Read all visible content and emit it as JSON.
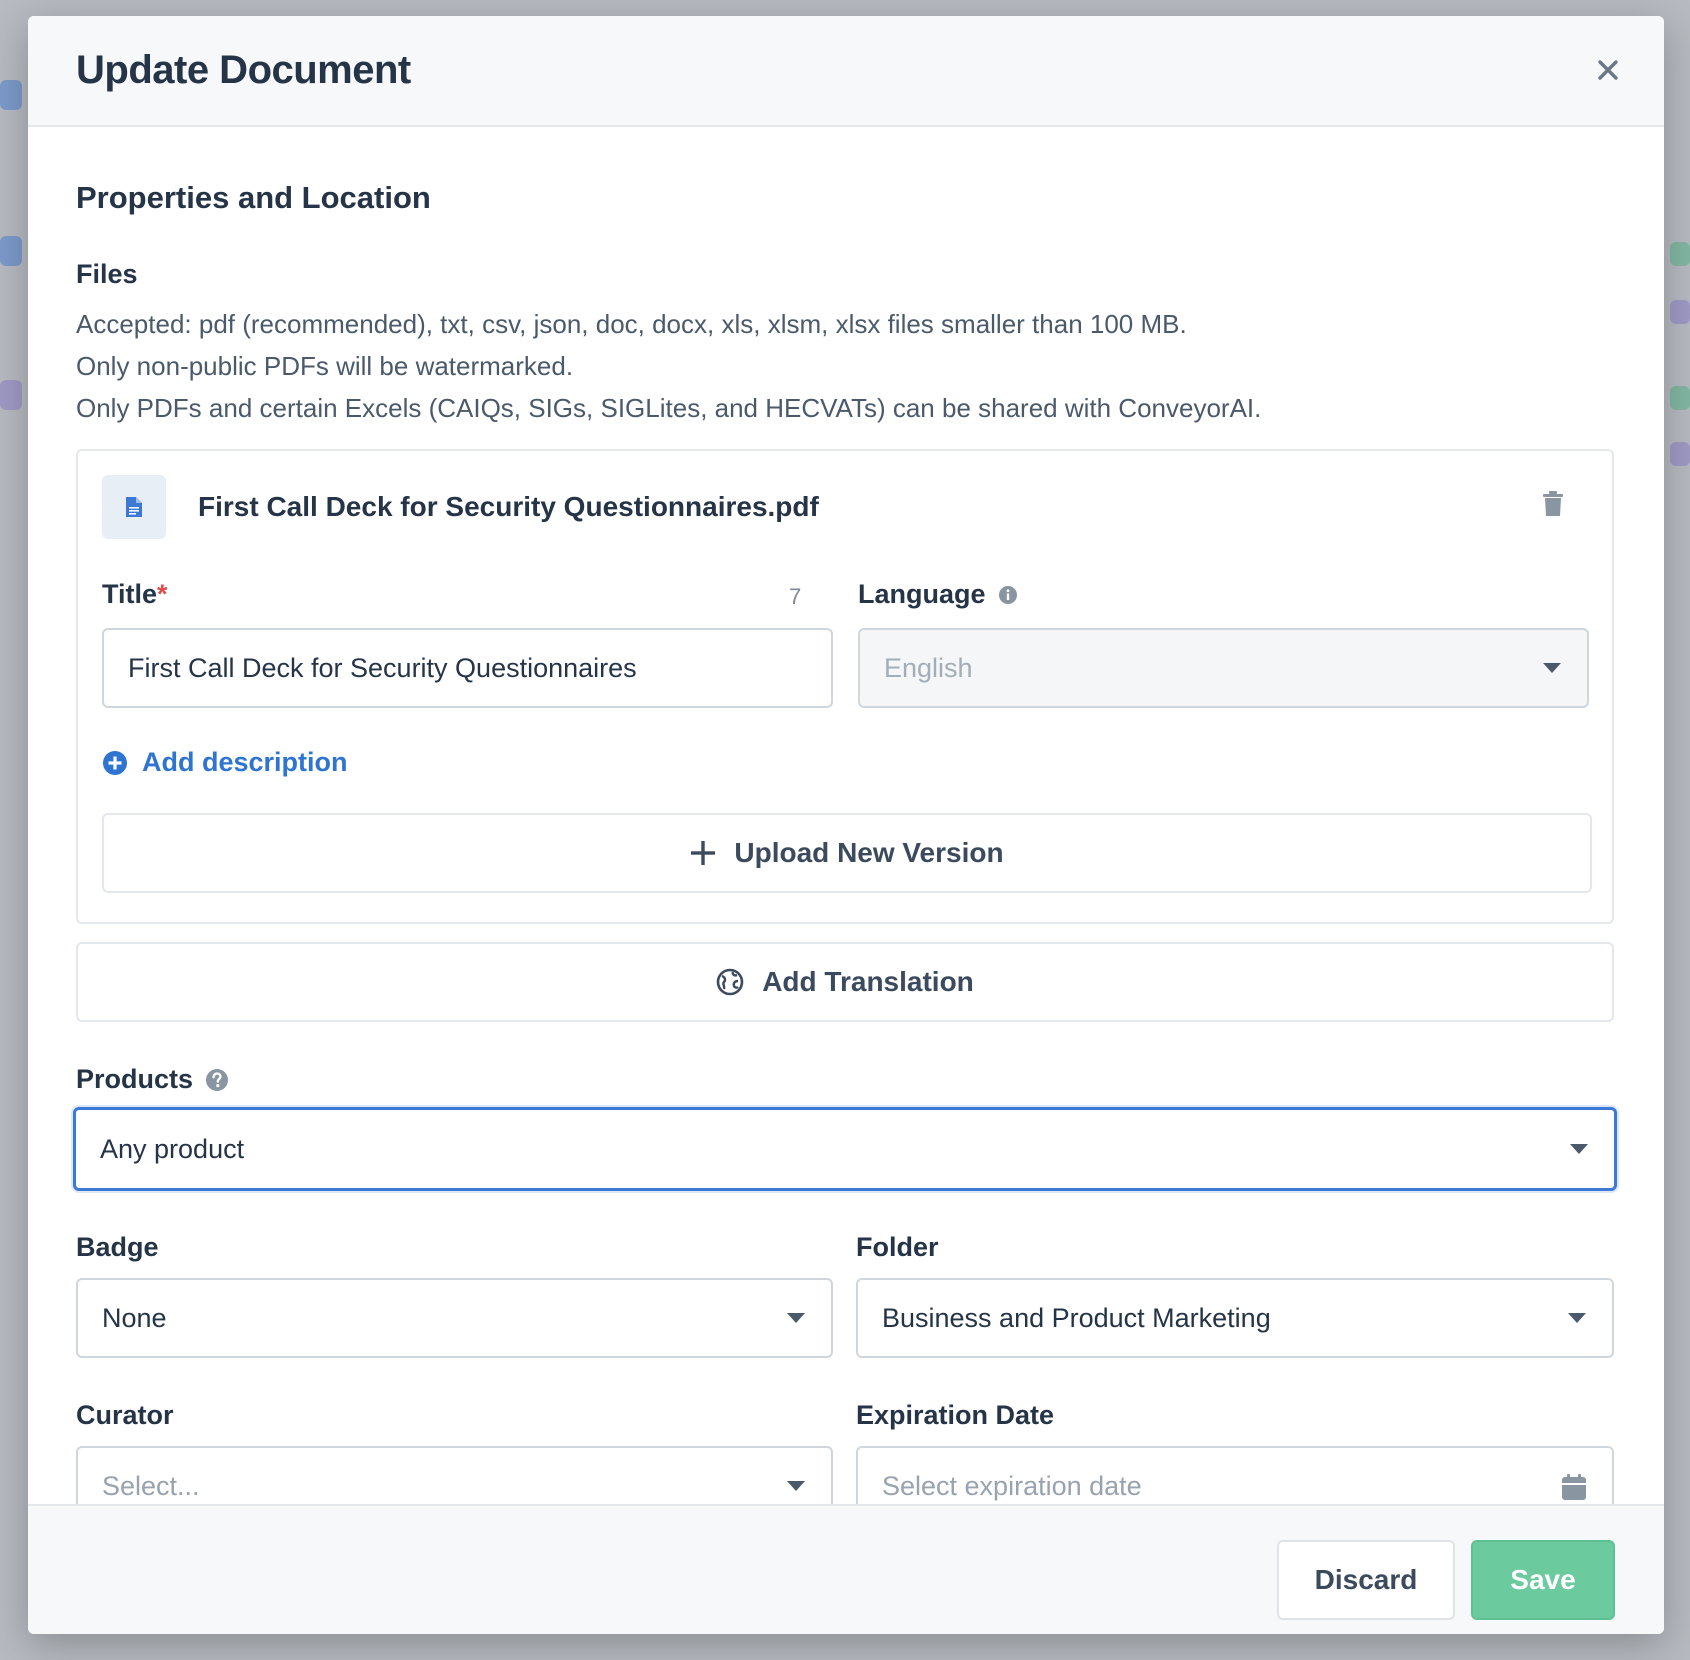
{
  "modal": {
    "title": "Update Document",
    "close_icon": "close-icon"
  },
  "section": {
    "title": "Properties and Location"
  },
  "files": {
    "label": "Files",
    "help_lines": [
      "Accepted: pdf (recommended), txt, csv, json, doc, docx, xls, xlsm, xlsx files smaller than 100 MB.",
      "Only non-public PDFs will be watermarked.",
      "Only PDFs and certain Excels (CAIQs, SIGs, SIGLites, and HECVATs) can be shared with ConveyorAI."
    ],
    "file_name": "First Call Deck for Security Questionnaires.pdf",
    "file_icon": "document-icon",
    "delete_icon": "trash-icon"
  },
  "title_field": {
    "label": "Title",
    "required_mark": "*",
    "counter": "7",
    "value": "First Call Deck for Security Questionnaires"
  },
  "language_field": {
    "label": "Language",
    "info_icon": "info-icon",
    "value": "English"
  },
  "add_description": {
    "label": "Add description",
    "icon": "plus-circle-icon"
  },
  "upload_new_version": {
    "label": "Upload New Version",
    "icon": "plus-icon"
  },
  "add_translation": {
    "label": "Add Translation",
    "icon": "globe-icon"
  },
  "products": {
    "label": "Products",
    "help_icon": "question-icon",
    "value": "Any product"
  },
  "badge": {
    "label": "Badge",
    "value": "None"
  },
  "folder": {
    "label": "Folder",
    "value": "Business and Product Marketing"
  },
  "curator": {
    "label": "Curator",
    "placeholder": "Select..."
  },
  "expiration": {
    "label": "Expiration Date",
    "placeholder": "Select expiration date",
    "icon": "calendar-icon"
  },
  "footer": {
    "discard_label": "Discard",
    "save_label": "Save"
  },
  "colors": {
    "accent": "#3b79d4",
    "link": "#2f74d0",
    "save": "#6bcb9e",
    "required": "#e04b4b"
  }
}
